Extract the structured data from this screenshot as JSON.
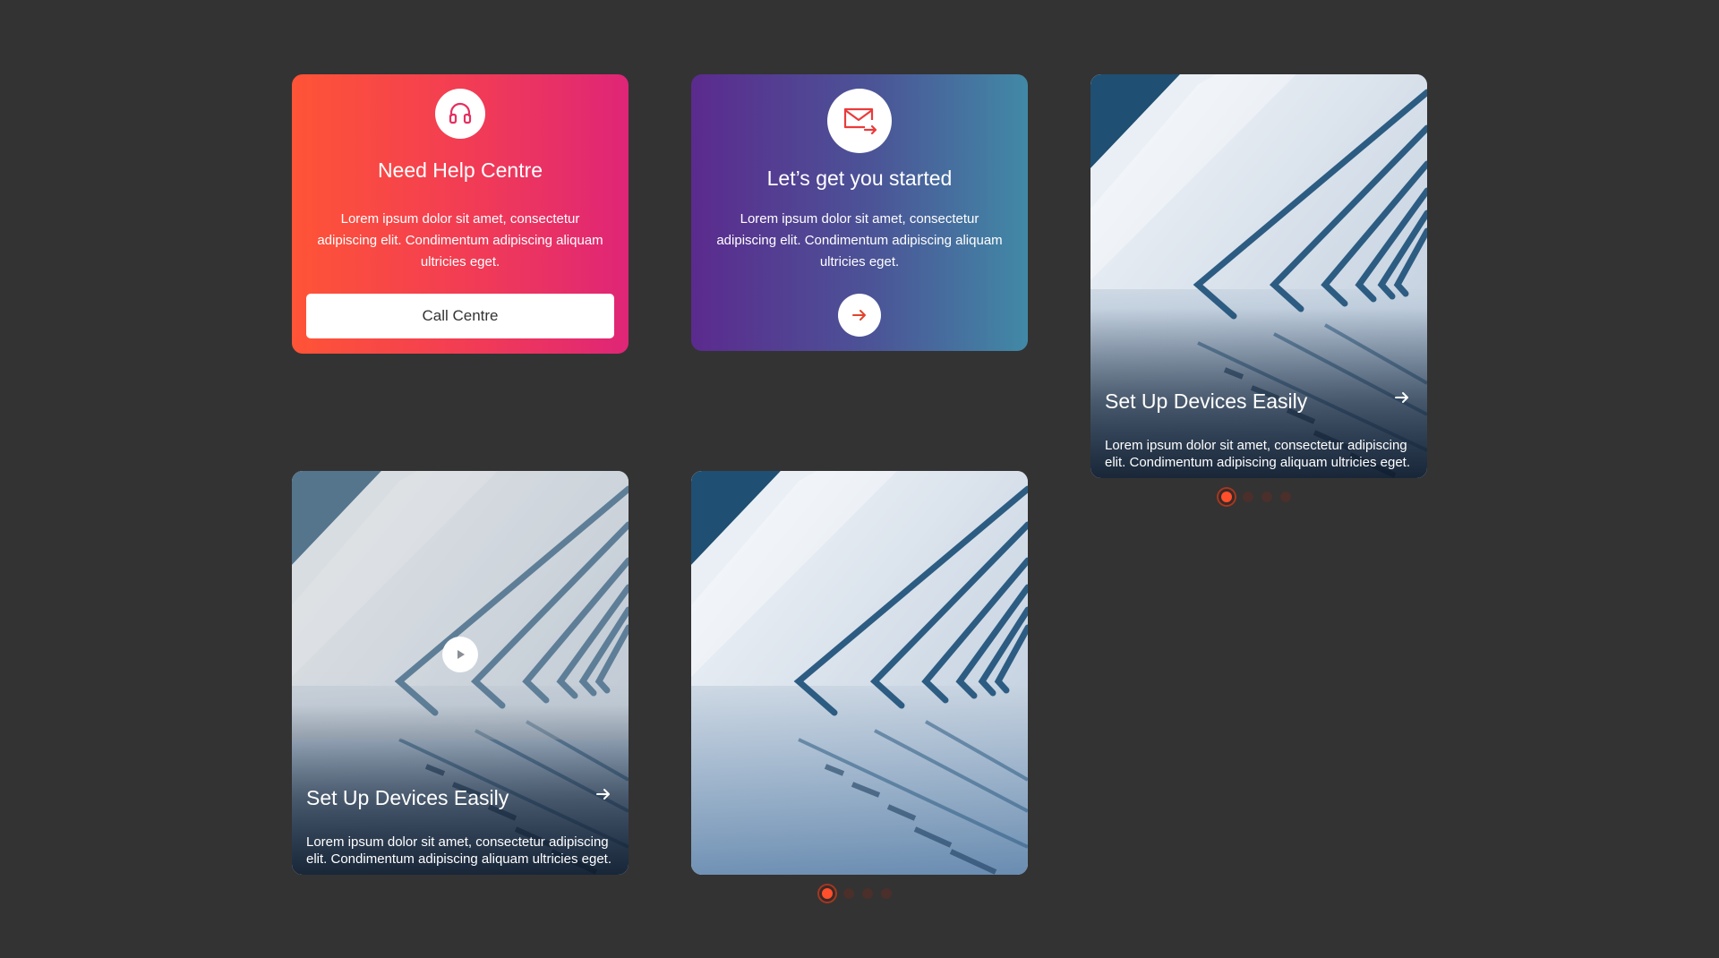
{
  "colors": {
    "page_background": "#333333",
    "help_gradient_start": "#ff5436",
    "help_gradient_end": "#df2577",
    "started_gradient_start": "#5b2a8e",
    "started_gradient_end": "#4189a6",
    "accent": "#ff4f2b"
  },
  "help_card": {
    "icon": "headset-icon",
    "title": "Need Help Centre",
    "text": "Lorem ipsum dolor sit amet, consectetur adipiscing elit. Condimentum adipiscing aliquam ultricies eget.",
    "button_label": "Call Centre"
  },
  "started_card": {
    "icon": "mail-forward-icon",
    "title": "Let’s get you started",
    "text": "Lorem ipsum dolor sit amet, consectetur adipiscing elit. Condimentum adipiscing aliquam ultricies eget.",
    "button_icon": "arrow-right-icon"
  },
  "image_cards": [
    {
      "title": "Set Up Devices Easily",
      "text": "Lorem ipsum dolor sit amet, consectetur adipiscing elit. Condimentum adipiscing aliquam ultricies eget.",
      "arrow_icon": "arrow-right-icon"
    },
    {
      "title": "Set Up Devices Easily",
      "text": "Lorem ipsum dolor sit amet, consectetur adipiscing elit. Condimentum adipiscing aliquam ultricies eget.",
      "arrow_icon": "arrow-right-icon",
      "overlay_icon": "play-icon"
    },
    {
      "image_only": true
    }
  ],
  "carousels": [
    {
      "dot_count": 4,
      "active_index": 0
    },
    {
      "dot_count": 4,
      "active_index": 0
    }
  ]
}
